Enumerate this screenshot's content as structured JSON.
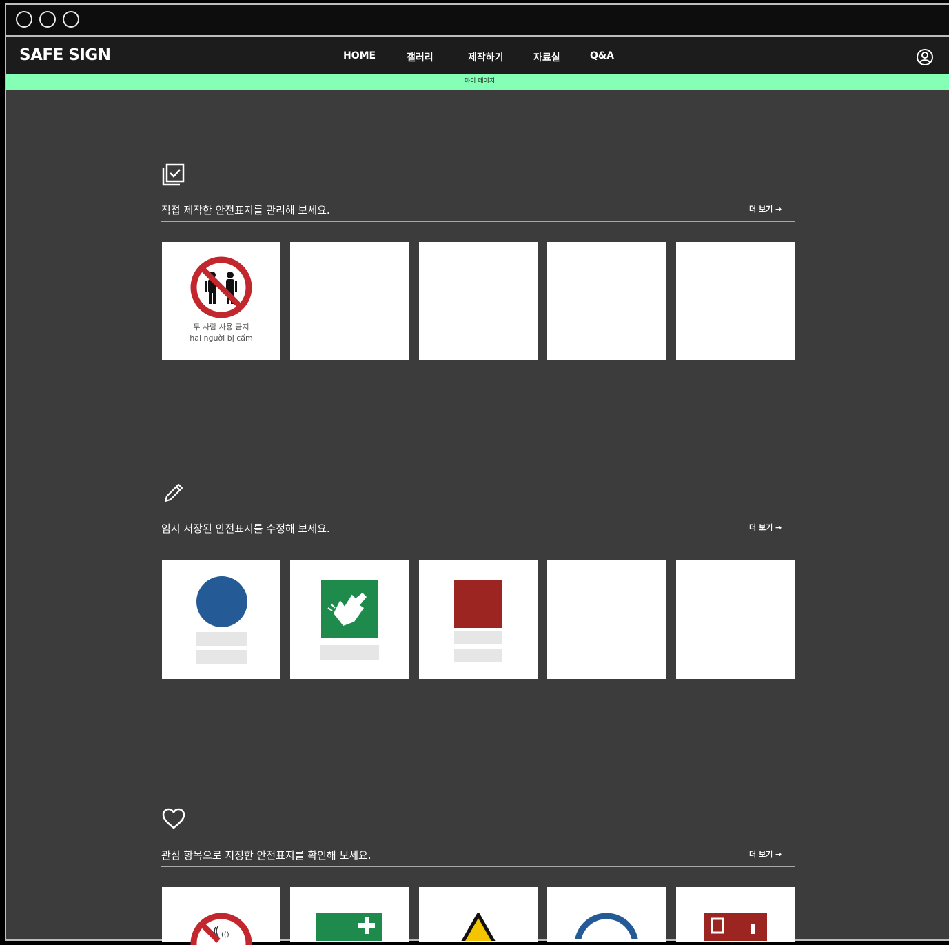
{
  "app": {
    "logo": "SAFE SIGN",
    "nav": [
      "HOME",
      "갤러리",
      "제작하기",
      "자료실",
      "Q&A"
    ],
    "sub_bar": "마이 페이지"
  },
  "sections": [
    {
      "icon": "gallery-check-icon",
      "title": "직접 제작한 안전표지를 관리해 보세요.",
      "more": "더 보기 →"
    },
    {
      "icon": "pencil-icon",
      "title": "임시 저장된 안전표지를 수정해 보세요.",
      "more": "더 보기 →"
    },
    {
      "icon": "heart-icon",
      "title": "관심 항목으로 지정한 안전표지를 확인해 보세요.",
      "more": "더 보기 →"
    }
  ],
  "cards": {
    "made_first_sign": {
      "line1": "두 사람 사용 금지",
      "line2": "hai người bị cấm"
    }
  },
  "colors": {
    "accent": "#84ffb5",
    "prohibition_red": "#c1272d",
    "mandatory_blue": "#245a96",
    "safe_green": "#1e8a4c",
    "fire_red": "#9c2521",
    "warning_yellow": "#f5c400"
  }
}
